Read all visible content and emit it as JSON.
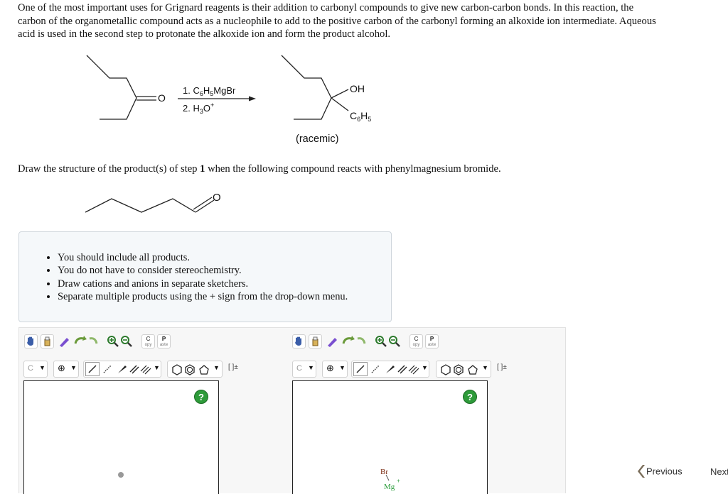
{
  "intro": {
    "line1": "One of the most important uses for Grignard reagents is their addition to carbonyl compounds to give new carbon-carbon bonds. In this reaction, the",
    "line2": "carbon of the organometallic compound acts as a nucleophile to add to the positive carbon of the carbonyl forming an alkoxide ion intermediate. Aqueous",
    "line3": "acid is used in the second step to protonate the alkoxide ion and form the product alcohol."
  },
  "reaction": {
    "reactant_atom": "O",
    "step1_prefix": "1. C",
    "step1_sub1": "6",
    "step1_mid": "H",
    "step1_sub2": "5",
    "step1_suffix": "MgBr",
    "step2_prefix": "2. H",
    "step2_sub": "3",
    "step2_mid": "O",
    "step2_sup": "+",
    "product_oh": "OH",
    "product_c": "C",
    "product_c_sub": "6",
    "product_h": "H",
    "product_h_sub": "5",
    "racemic": "(racemic)"
  },
  "question": {
    "prefix": "Draw the structure of the product(s) of step ",
    "step": "1",
    "suffix": " when the following compound reacts with phenylmagnesium bromide."
  },
  "compound_atom": "O",
  "instructions": [
    "You should include all products.",
    "You do not have to consider stereochemistry.",
    "Draw cations and anions in separate sketchers.",
    "Separate multiple products using the + sign from the drop-down menu."
  ],
  "toolbar": {
    "copy_top": "C",
    "copy_bottom": "opy",
    "paste_top": "P",
    "paste_bottom": "aste",
    "element_label": "C",
    "charge_label": "⊕",
    "bracket_label": "[ ]±",
    "help_label": "?"
  },
  "sketcher2": {
    "atom1": "Br",
    "atom2": "Mg",
    "charge": "+"
  },
  "nav": {
    "previous": "Previous",
    "next": "Next"
  },
  "colors": {
    "help_green": "#2e9b3a",
    "br_color": "#7a2b12",
    "mg_color": "#2a9c3a",
    "note_bg": "#f5f8fa"
  }
}
